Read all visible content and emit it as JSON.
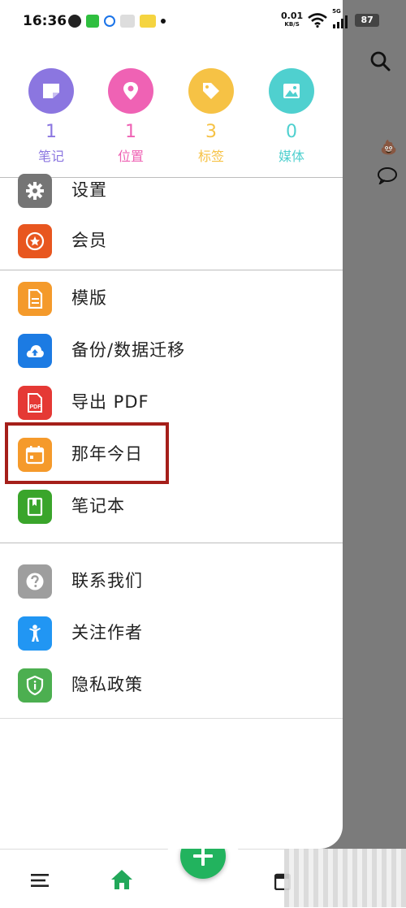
{
  "status_bar": {
    "time": "16:36",
    "net_speed_value": "0.01",
    "net_speed_unit": "KB/S",
    "signal_tag": "5G",
    "battery": "87"
  },
  "stats": [
    {
      "count": "1",
      "label": "笔记",
      "color": "#8b76e0",
      "icon": "note-icon"
    },
    {
      "count": "1",
      "label": "位置",
      "color": "#ef62b4",
      "icon": "location-pin-icon"
    },
    {
      "count": "3",
      "label": "标签",
      "color": "#f6c245",
      "icon": "tag-icon"
    },
    {
      "count": "0",
      "label": "媒体",
      "color": "#4fd0cf",
      "icon": "image-icon"
    }
  ],
  "menu_group1": [
    {
      "label": "设置",
      "color": "#757575",
      "icon": "gear-icon"
    },
    {
      "label": "会员",
      "color": "#e8561f",
      "icon": "star-badge-icon"
    }
  ],
  "menu_group2": [
    {
      "label": "模版",
      "color": "#f49a2b",
      "icon": "template-icon"
    },
    {
      "label": "备份/数据迁移",
      "color": "#1c7be3",
      "icon": "cloud-upload-icon"
    },
    {
      "label": "导出 PDF",
      "color": "#e53935",
      "icon": "pdf-icon"
    },
    {
      "label": "那年今日",
      "color": "#f59a2b",
      "icon": "calendar-icon"
    },
    {
      "label": "笔记本",
      "color": "#3aa52b",
      "icon": "notebook-icon"
    }
  ],
  "menu_group3": [
    {
      "label": "联系我们",
      "color": "#9e9e9e",
      "icon": "question-icon"
    },
    {
      "label": "关注作者",
      "color": "#2196f3",
      "icon": "person-icon"
    },
    {
      "label": "隐私政策",
      "color": "#4caf50",
      "icon": "shield-icon"
    }
  ],
  "colors": {
    "fab": "#22b35e",
    "highlight": "#a51f1a",
    "overlay": "#7b7b7b"
  }
}
